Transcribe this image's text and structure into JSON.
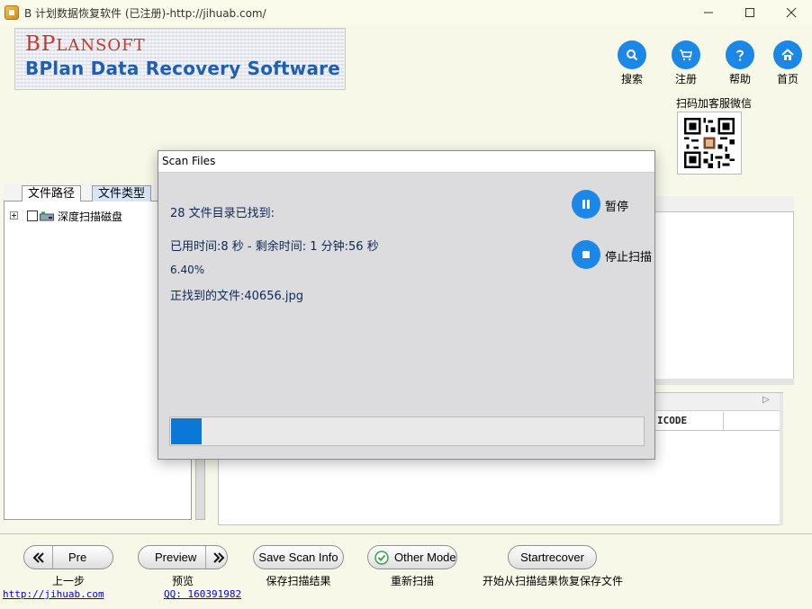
{
  "window": {
    "title": "B 计划数据恢复软件 (已注册)-http://jihuab.com/"
  },
  "banner": {
    "logo_initial_1": "B",
    "logo_rest_1": "P",
    "logo_tail": "LANSOFT",
    "product_title": "BPlan Data Recovery Software"
  },
  "top_buttons": [
    {
      "label": "搜索",
      "icon": "search-icon"
    },
    {
      "label": "注册",
      "icon": "cart-icon"
    },
    {
      "label": "帮助",
      "icon": "help-icon"
    },
    {
      "label": "首页",
      "icon": "home-icon"
    }
  ],
  "qr": {
    "caption": "扫码加客服微信"
  },
  "left_panel": {
    "tabs": [
      "文件路径",
      "文件类型"
    ],
    "tree_items": [
      {
        "label": "深度扫描磁盘",
        "checked": false
      }
    ]
  },
  "right_panel": {
    "column_header": "ICODE"
  },
  "dialog": {
    "title": "Scan Files",
    "dirs_found": "28 文件目录已找到:",
    "time_info": "已用时间:8 秒 - 剩余时间: 1 分钟:56 秒",
    "percent": "6.40%",
    "progress_fraction": 0.064,
    "current_file": "正找到的文件:40656.jpg",
    "pause_label": "暂停",
    "stop_label": "停止扫描"
  },
  "bottom_buttons": [
    {
      "name": "pre",
      "label": "Pre",
      "caption": "上一步"
    },
    {
      "name": "preview",
      "label": "Preview",
      "caption": "预览"
    },
    {
      "name": "save-scan-info",
      "label": "Save Scan Info",
      "caption": "保存扫描结果"
    },
    {
      "name": "other-mode",
      "label": "Other Mode",
      "caption": "重新扫描"
    },
    {
      "name": "startrecover",
      "label": "Startrecover",
      "caption": "开始从扫描结果恢复保存文件"
    }
  ],
  "footer": {
    "link": "http://jihuab.com",
    "qq": "QQ: 160391982"
  },
  "colors": {
    "accent": "#1b87e6",
    "progress": "#0a78d6",
    "brand_red": "#c5372a",
    "brand_blue": "#1f5fb0"
  }
}
